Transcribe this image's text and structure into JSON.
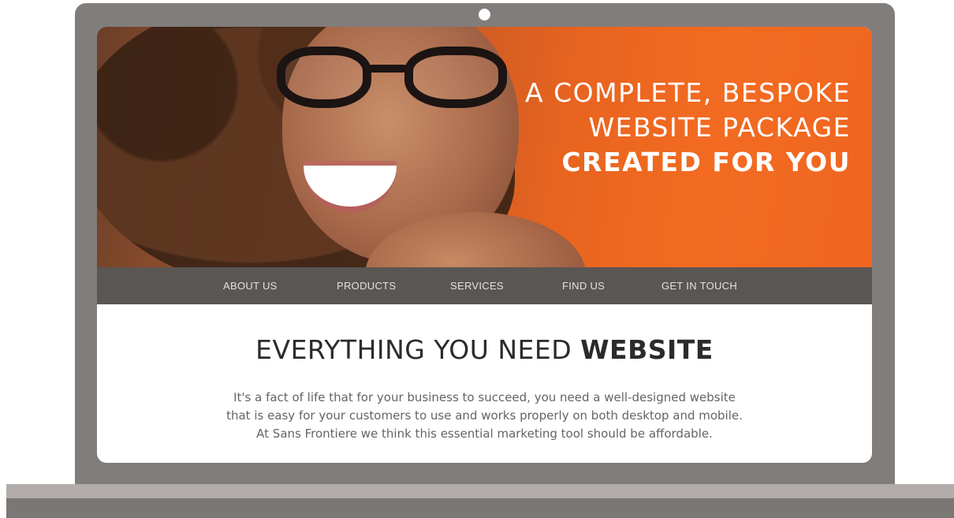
{
  "hero": {
    "line1": "A COMPLETE, BESPOKE",
    "line2": "WEBSITE PACKAGE",
    "line3": "CREATED FOR YOU"
  },
  "nav": {
    "items": [
      {
        "label": "ABOUT US"
      },
      {
        "label": "PRODUCTS"
      },
      {
        "label": "SERVICES"
      },
      {
        "label": "FIND US"
      },
      {
        "label": "GET IN TOUCH"
      }
    ]
  },
  "content": {
    "title_regular": "EVERYTHING YOU NEED",
    "title_bold": "WEBSITE",
    "paragraph_lines": [
      "It's a fact of life that for your business to succeed, you need a well-designed website",
      "that is easy for your customers to use and works properly on both desktop and mobile.",
      "At Sans Frontiere we think this essential marketing tool should be affordable."
    ]
  },
  "colors": {
    "bezel": "#817d7b",
    "nav_bg": "#5a5653",
    "hero_orange": "#f36b21"
  }
}
